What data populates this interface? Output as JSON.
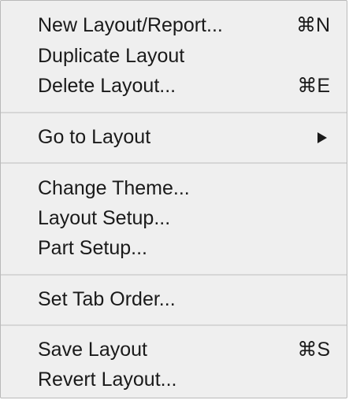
{
  "menu": {
    "groups": [
      {
        "items": [
          {
            "label": "New Layout/Report...",
            "shortcut": "⌘N"
          },
          {
            "label": "Duplicate Layout",
            "shortcut": ""
          },
          {
            "label": "Delete Layout...",
            "shortcut": "⌘E"
          }
        ]
      },
      {
        "items": [
          {
            "label": "Go to Layout",
            "submenu_icon": "submenu-arrow-icon"
          }
        ]
      },
      {
        "items": [
          {
            "label": "Change Theme..."
          },
          {
            "label": "Layout Setup..."
          },
          {
            "label": "Part Setup..."
          }
        ]
      },
      {
        "items": [
          {
            "label": "Set Tab Order..."
          }
        ]
      },
      {
        "items": [
          {
            "label": "Save Layout",
            "shortcut": "⌘S"
          },
          {
            "label": "Revert Layout..."
          }
        ]
      }
    ]
  }
}
